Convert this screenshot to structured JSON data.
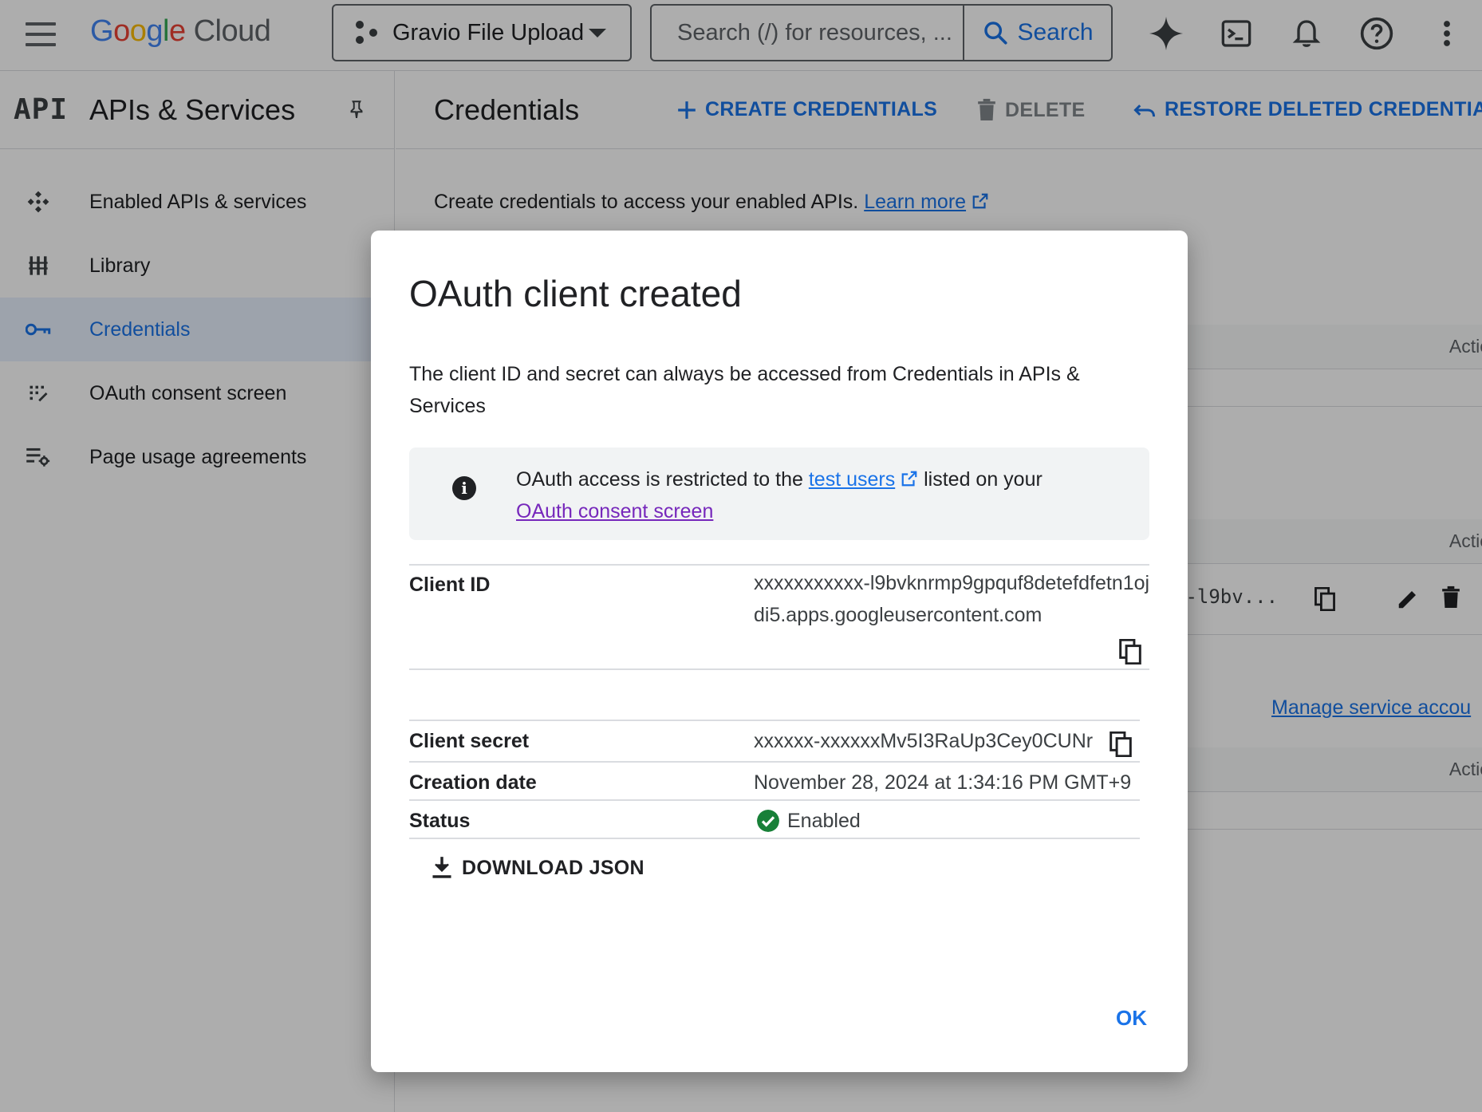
{
  "topbar": {
    "logo_google": [
      "G",
      "o",
      "o",
      "g",
      "l",
      "e"
    ],
    "logo_cloud": "Cloud",
    "project_name": "Gravio File Upload",
    "search_placeholder": "Search (/) for resources, docs, products and more",
    "search_display": "Search (/) for resources, ...",
    "search_button": "Search",
    "icons": [
      "gemini-sparkle-icon",
      "cloud-shell-icon",
      "notifications-bell-icon",
      "help-icon",
      "more-vert-icon"
    ]
  },
  "leftnav": {
    "badge": "API",
    "title": "APIs & Services",
    "items": [
      {
        "label": "Enabled APIs & services",
        "icon": "enabled-apis-icon",
        "active": false
      },
      {
        "label": "Library",
        "icon": "library-icon",
        "active": false
      },
      {
        "label": "Credentials",
        "icon": "key-icon",
        "active": true
      },
      {
        "label": "OAuth consent screen",
        "icon": "consent-screen-icon",
        "active": false
      },
      {
        "label": "Page usage agreements",
        "icon": "page-usage-icon",
        "active": false
      }
    ]
  },
  "main": {
    "title": "Credentials",
    "actions": {
      "create": "CREATE CREDENTIALS",
      "delete": "DELETE",
      "restore": "RESTORE DELETED CREDENTIALS"
    },
    "intro_text": "Create credentials to access your enabled APIs.",
    "learn_more": "Learn more",
    "actions_header": "Actio",
    "truncated_id": "1-l9bv...",
    "manage_link": "Manage service accou"
  },
  "dialog": {
    "title": "OAuth client created",
    "description": "The client ID and secret can always be accessed from Credentials in APIs & Services",
    "info": {
      "prefix": "OAuth access is restricted to the",
      "test_users": "test users",
      "middle": "listed on your",
      "consent_link": "OAuth consent screen"
    },
    "client_id_label": "Client ID",
    "client_id_value": "xxxxxxxxxxx-l9bvknrmp9gpquf8detefdfetn1ojdi5.apps.googleusercontent.com",
    "client_secret_label": "Client secret",
    "client_secret_value": "xxxxxx-xxxxxxMv5I3RaUp3Cey0CUNr",
    "creation_date_label": "Creation date",
    "creation_date_value": "November 28, 2024 at 1:34:16 PM GMT+9",
    "status_label": "Status",
    "status_value": "Enabled",
    "download_label": "DOWNLOAD JSON",
    "ok_label": "OK"
  },
  "colors": {
    "accent": "#1a73e8",
    "status_ok": "#188038",
    "visited_link": "#7627bb"
  }
}
